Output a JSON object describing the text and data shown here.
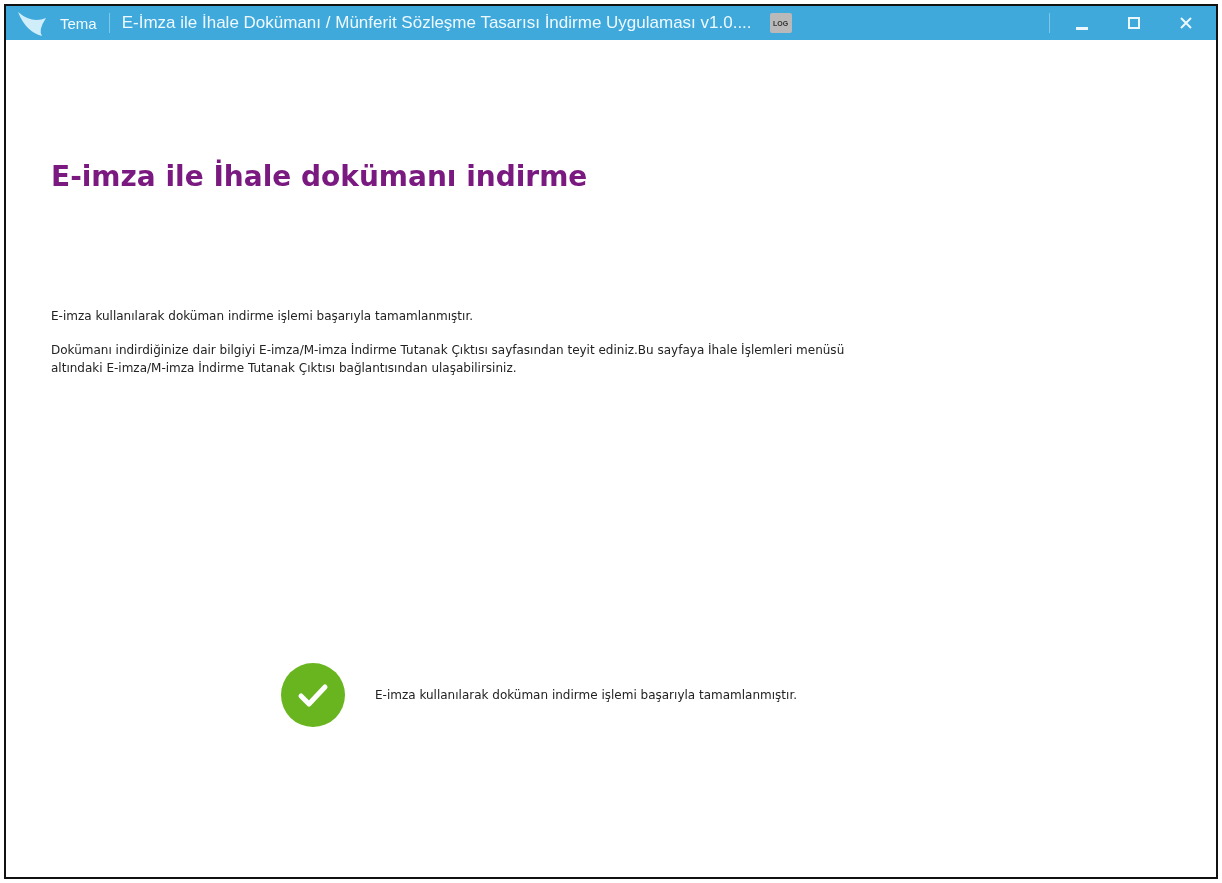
{
  "window": {
    "app_name": "Tema",
    "title": "E-İmza ile İhale Dokümanı / Münferit Sözleşme Tasarısı İndirme Uygulaması v1.0....",
    "log_label": "LOG"
  },
  "heading": "E-imza ile İhale dokümanı indirme",
  "paragraphs": [
    "E-imza kullanılarak doküman indirme işlemi başarıyla tamamlanmıştır.",
    "Dokümanı indirdiğinize dair bilgiyi E-imza/M-imza İndirme Tutanak Çıktısı sayfasından teyit ediniz.Bu sayfaya İhale İşlemleri menüsü altındaki E-imza/M-imza İndirme Tutanak Çıktısı bağlantısından ulaşabilirsiniz."
  ],
  "status": {
    "kind": "success",
    "message": "E-imza kullanılarak doküman indirme işlemi başarıyla tamamlanmıştır."
  }
}
